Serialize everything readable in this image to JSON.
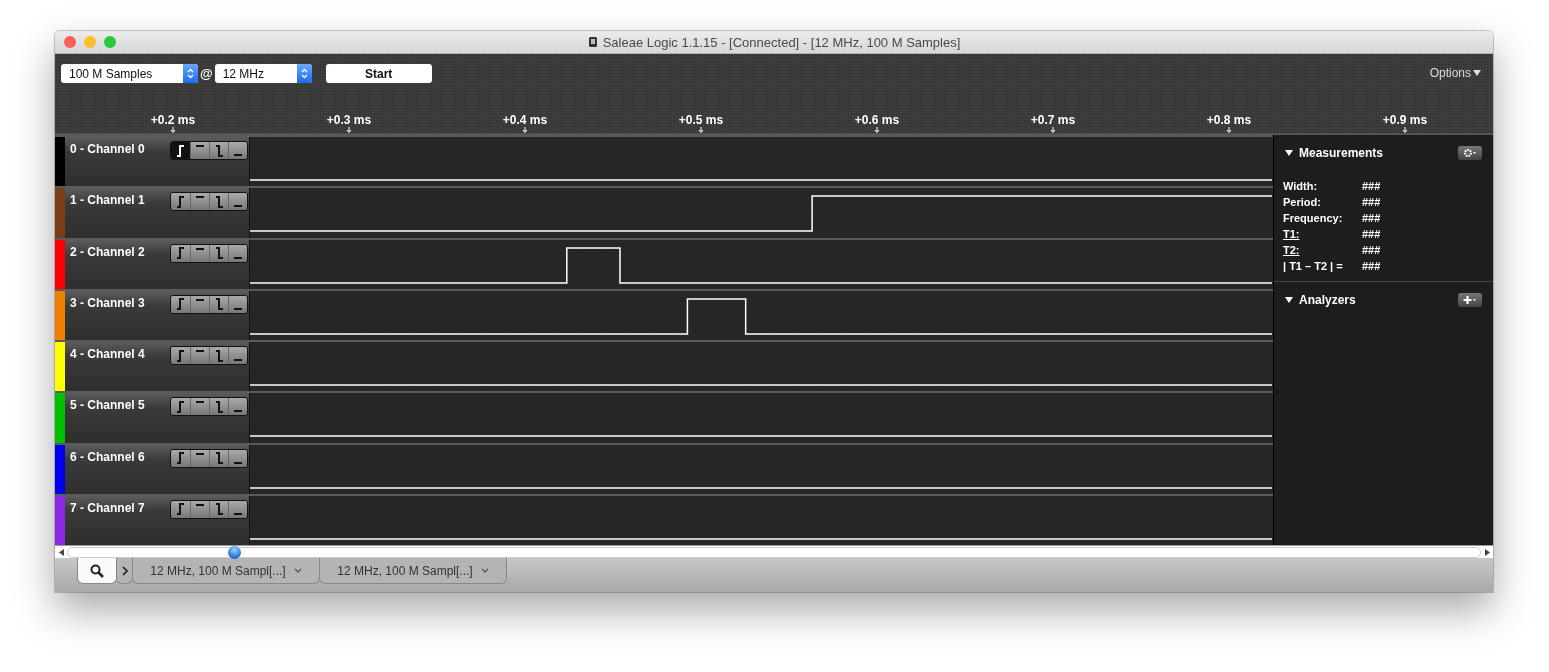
{
  "window": {
    "title": "Saleae Logic 1.1.15 - [Connected] - [12 MHz, 100 M Samples]"
  },
  "toolbar": {
    "samples": "100 M Samples",
    "at": "@",
    "rate": "12 MHz",
    "start": "Start",
    "options": "Options"
  },
  "ruler": [
    "+0.2 ms",
    "+0.3 ms",
    "+0.4 ms",
    "+0.5 ms",
    "+0.6 ms",
    "+0.7 ms",
    "+0.8 ms",
    "+0.9 ms"
  ],
  "channels": [
    {
      "name": "0 - Channel 0",
      "color": "#000000",
      "triggers": [
        {
          "kind": "rising",
          "selected": true
        },
        {
          "kind": "high",
          "selected": false
        },
        {
          "kind": "falling",
          "selected": false
        },
        {
          "kind": "low",
          "selected": false
        }
      ]
    },
    {
      "name": "1 - Channel 1",
      "color": "#7a3f12",
      "triggers": [
        {
          "kind": "rising",
          "selected": false
        },
        {
          "kind": "high",
          "selected": false
        },
        {
          "kind": "falling",
          "selected": false
        },
        {
          "kind": "low",
          "selected": false
        }
      ]
    },
    {
      "name": "2 - Channel 2",
      "color": "#ff0000",
      "triggers": [
        {
          "kind": "rising",
          "selected": false
        },
        {
          "kind": "high",
          "selected": false
        },
        {
          "kind": "falling",
          "selected": false
        },
        {
          "kind": "low",
          "selected": false
        }
      ]
    },
    {
      "name": "3 - Channel 3",
      "color": "#f08000",
      "triggers": [
        {
          "kind": "rising",
          "selected": false
        },
        {
          "kind": "high",
          "selected": false
        },
        {
          "kind": "falling",
          "selected": false
        },
        {
          "kind": "low",
          "selected": false
        }
      ]
    },
    {
      "name": "4 - Channel 4",
      "color": "#ffff00",
      "triggers": [
        {
          "kind": "rising",
          "selected": false
        },
        {
          "kind": "high",
          "selected": false
        },
        {
          "kind": "falling",
          "selected": false
        },
        {
          "kind": "low",
          "selected": false
        }
      ]
    },
    {
      "name": "5 - Channel 5",
      "color": "#00c000",
      "triggers": [
        {
          "kind": "rising",
          "selected": false
        },
        {
          "kind": "high",
          "selected": false
        },
        {
          "kind": "falling",
          "selected": false
        },
        {
          "kind": "low",
          "selected": false
        }
      ]
    },
    {
      "name": "6 - Channel 6",
      "color": "#0000ee",
      "triggers": [
        {
          "kind": "rising",
          "selected": false
        },
        {
          "kind": "high",
          "selected": false
        },
        {
          "kind": "falling",
          "selected": false
        },
        {
          "kind": "low",
          "selected": false
        }
      ]
    },
    {
      "name": "7 - Channel 7",
      "color": "#8a2be2",
      "triggers": [
        {
          "kind": "rising",
          "selected": false
        },
        {
          "kind": "high",
          "selected": false
        },
        {
          "kind": "falling",
          "selected": false
        },
        {
          "kind": "low",
          "selected": false
        }
      ]
    }
  ],
  "measurements": {
    "title": "Measurements",
    "rows": [
      {
        "label": "Width:",
        "value": "###"
      },
      {
        "label": "Period:",
        "value": "###"
      },
      {
        "label": "Frequency:",
        "value": "###"
      },
      {
        "label": "T1:",
        "value": "###"
      },
      {
        "label": "T2:",
        "value": "###"
      },
      {
        "label": "| T1 – T2 | =",
        "value": "###"
      }
    ]
  },
  "analyzers": {
    "title": "Analyzers"
  },
  "tabs": [
    {
      "kind": "search",
      "selected": true
    },
    {
      "kind": "expand",
      "selected": false
    },
    {
      "kind": "session",
      "label": "12 MHz, 100 M Sampl[...]",
      "selected": false
    },
    {
      "kind": "session",
      "label": "12 MHz, 100 M Sampl[...]",
      "selected": false
    }
  ]
}
